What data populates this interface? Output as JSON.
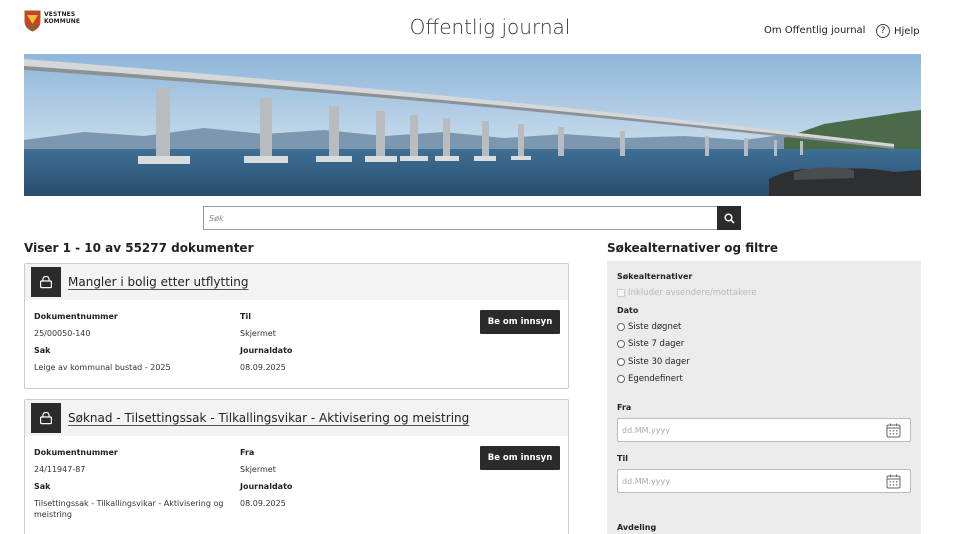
{
  "header": {
    "logo_line1": "VESTNES",
    "logo_line2": "KOMMUNE",
    "title": "Offentlig journal",
    "about_link": "Om Offentlig journal",
    "help_link": "Hjelp"
  },
  "search": {
    "placeholder": "Søk"
  },
  "results": {
    "count_text": "Viser 1 - 10 av 55277 dokumenter",
    "request_label": "Be om innsyn",
    "items": [
      {
        "title": "Mangler i bolig etter utflytting",
        "doc_label": "Dokumentnummer",
        "doc_value": "25/00050-140",
        "party_label": "Til",
        "party_value": "Skjermet",
        "case_label": "Sak",
        "case_value": "Leige av kommunal bustad - 2025",
        "date_label": "Journaldato",
        "date_value": "08.09.2025"
      },
      {
        "title": "Søknad - Tilsettingssak - Tilkallingsvikar - Aktivisering og meistring",
        "doc_label": "Dokumentnummer",
        "doc_value": "24/11947-87",
        "party_label": "Fra",
        "party_value": "Skjermet",
        "case_label": "Sak",
        "case_value": "Tilsettingssak - Tilkallingsvikar - Aktivisering og meistring",
        "date_label": "Journaldato",
        "date_value": "08.09.2025"
      }
    ]
  },
  "filters": {
    "title": "Søkealternativer og filtre",
    "options_heading": "Søkealternativer",
    "include_sender": "Inkluder avsendere/mottakere",
    "date_heading": "Dato",
    "date_options": [
      "Siste døgnet",
      "Siste 7 dager",
      "Siste 30 dager",
      "Egendefinert"
    ],
    "from_label": "Fra",
    "from_placeholder": "dd.MM.yyyy",
    "to_label": "Til",
    "to_placeholder": "dd.MM.yyyy",
    "department_label": "Avdeling"
  }
}
